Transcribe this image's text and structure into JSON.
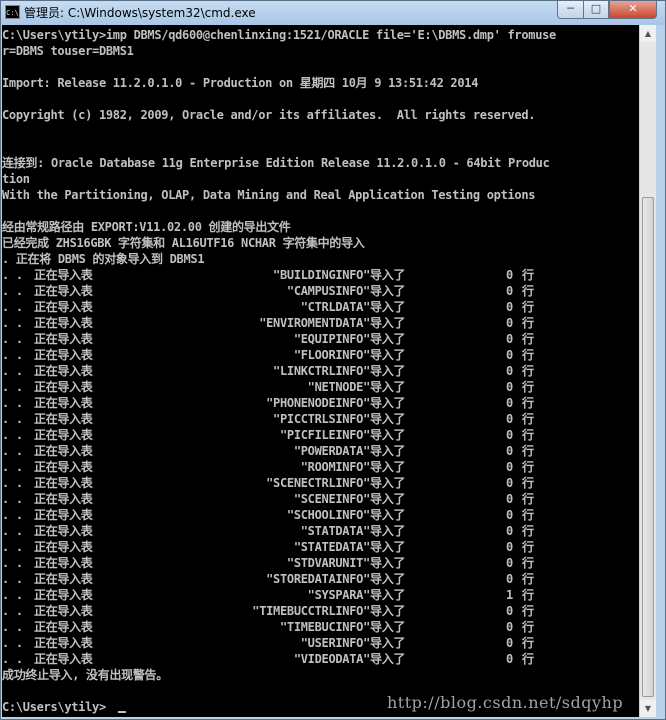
{
  "window": {
    "title": "管理员: C:\\Windows\\system32\\cmd.exe",
    "app_icon_text": "C:\\",
    "buttons": {
      "minimize": "─",
      "maximize": "□",
      "close": "✕"
    },
    "icons": {
      "app": "cmd-icon",
      "minimize": "minimize-icon",
      "maximize": "maximize-icon",
      "close": "close-icon",
      "scroll_up": "scroll-up-arrow-icon",
      "scroll_down": "scroll-down-arrow-icon"
    }
  },
  "console": {
    "header_lines": [
      "C:\\Users\\ytily>imp DBMS/qd600@chenlinxing:1521/ORACLE file='E:\\DBMS.dmp' fromuse",
      "r=DBMS touser=DBMS1",
      "",
      "Import: Release 11.2.0.1.0 - Production on 星期四 10月 9 13:51:42 2014",
      "",
      "Copyright (c) 1982, 2009, Oracle and/or its affiliates.  All rights reserved.",
      "",
      "",
      "连接到: Oracle Database 11g Enterprise Edition Release 11.2.0.1.0 - 64bit Produc",
      "tion",
      "With the Partitioning, OLAP, Data Mining and Real Application Testing options",
      "",
      "经由常规路径由 EXPORT:V11.02.00 创建的导出文件",
      "已经完成 ZHS16GBK 字符集和 AL16UTF16 NCHAR 字符集中的导入",
      ". 正在将 DBMS 的对象导入到 DBMS1"
    ],
    "import_rows": [
      {
        "prefix": ". .",
        "label": "正在导入表",
        "table": "\"BUILDINGINFO\"",
        "verb": "导入了",
        "count": "0",
        "unit": "行"
      },
      {
        "prefix": ". .",
        "label": "正在导入表",
        "table": "\"CAMPUSINFO\"",
        "verb": "导入了",
        "count": "0",
        "unit": "行"
      },
      {
        "prefix": ". .",
        "label": "正在导入表",
        "table": "\"CTRLDATA\"",
        "verb": "导入了",
        "count": "0",
        "unit": "行"
      },
      {
        "prefix": ". .",
        "label": "正在导入表",
        "table": "\"ENVIROMENTDATA\"",
        "verb": "导入了",
        "count": "0",
        "unit": "行"
      },
      {
        "prefix": ". .",
        "label": "正在导入表",
        "table": "\"EQUIPINFO\"",
        "verb": "导入了",
        "count": "0",
        "unit": "行"
      },
      {
        "prefix": ". .",
        "label": "正在导入表",
        "table": "\"FLOORINFO\"",
        "verb": "导入了",
        "count": "0",
        "unit": "行"
      },
      {
        "prefix": ". .",
        "label": "正在导入表",
        "table": "\"LINKCTRLINFO\"",
        "verb": "导入了",
        "count": "0",
        "unit": "行"
      },
      {
        "prefix": ". .",
        "label": "正在导入表",
        "table": "\"NETNODE\"",
        "verb": "导入了",
        "count": "0",
        "unit": "行"
      },
      {
        "prefix": ". .",
        "label": "正在导入表",
        "table": "\"PHONENODEINFO\"",
        "verb": "导入了",
        "count": "0",
        "unit": "行"
      },
      {
        "prefix": ". .",
        "label": "正在导入表",
        "table": "\"PICCTRLSINFO\"",
        "verb": "导入了",
        "count": "0",
        "unit": "行"
      },
      {
        "prefix": ". .",
        "label": "正在导入表",
        "table": "\"PICFILEINFO\"",
        "verb": "导入了",
        "count": "0",
        "unit": "行"
      },
      {
        "prefix": ". .",
        "label": "正在导入表",
        "table": "\"POWERDATA\"",
        "verb": "导入了",
        "count": "0",
        "unit": "行"
      },
      {
        "prefix": ". .",
        "label": "正在导入表",
        "table": "\"ROOMINFO\"",
        "verb": "导入了",
        "count": "0",
        "unit": "行"
      },
      {
        "prefix": ". .",
        "label": "正在导入表",
        "table": "\"SCENECTRLINFO\"",
        "verb": "导入了",
        "count": "0",
        "unit": "行"
      },
      {
        "prefix": ". .",
        "label": "正在导入表",
        "table": "\"SCENEINFO\"",
        "verb": "导入了",
        "count": "0",
        "unit": "行"
      },
      {
        "prefix": ". .",
        "label": "正在导入表",
        "table": "\"SCHOOLINFO\"",
        "verb": "导入了",
        "count": "0",
        "unit": "行"
      },
      {
        "prefix": ". .",
        "label": "正在导入表",
        "table": "\"STATDATA\"",
        "verb": "导入了",
        "count": "0",
        "unit": "行"
      },
      {
        "prefix": ". .",
        "label": "正在导入表",
        "table": "\"STATEDATA\"",
        "verb": "导入了",
        "count": "0",
        "unit": "行"
      },
      {
        "prefix": ". .",
        "label": "正在导入表",
        "table": "\"STDVARUNIT\"",
        "verb": "导入了",
        "count": "0",
        "unit": "行"
      },
      {
        "prefix": ". .",
        "label": "正在导入表",
        "table": "\"STOREDATAINFO\"",
        "verb": "导入了",
        "count": "0",
        "unit": "行"
      },
      {
        "prefix": ". .",
        "label": "正在导入表",
        "table": "\"SYSPARA\"",
        "verb": "导入了",
        "count": "1",
        "unit": "行"
      },
      {
        "prefix": ". .",
        "label": "正在导入表",
        "table": "\"TIMEBUCCTRLINFO\"",
        "verb": "导入了",
        "count": "0",
        "unit": "行"
      },
      {
        "prefix": ". .",
        "label": "正在导入表",
        "table": "\"TIMEBUCINFO\"",
        "verb": "导入了",
        "count": "0",
        "unit": "行"
      },
      {
        "prefix": ". .",
        "label": "正在导入表",
        "table": "\"USERINFO\"",
        "verb": "导入了",
        "count": "0",
        "unit": "行"
      },
      {
        "prefix": ". .",
        "label": "正在导入表",
        "table": "\"VIDEODATA\"",
        "verb": "导入了",
        "count": "0",
        "unit": "行"
      }
    ],
    "footer_lines": [
      "成功终止导入, 没有出现警告。",
      "",
      "C:\\Users\\ytily>"
    ],
    "watermark": "http://blog.csdn.net/sdqyhp"
  }
}
